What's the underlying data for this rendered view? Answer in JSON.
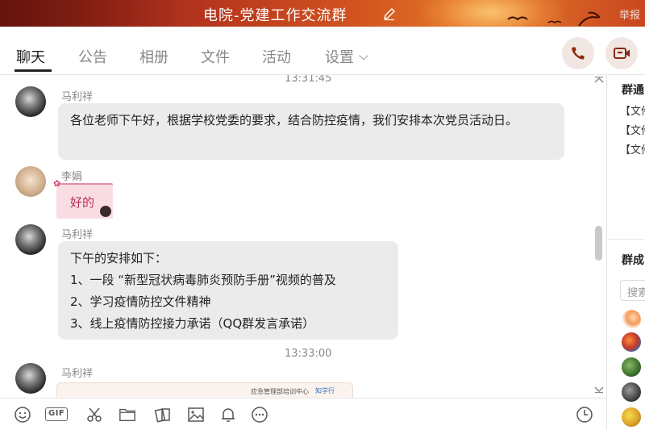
{
  "window": {
    "title": "电院-党建工作交流群",
    "report_label": "举报"
  },
  "tabs": [
    {
      "label": "聊天",
      "active": true
    },
    {
      "label": "公告",
      "active": false
    },
    {
      "label": "相册",
      "active": false
    },
    {
      "label": "文件",
      "active": false
    },
    {
      "label": "活动",
      "active": false
    },
    {
      "label": "设置",
      "active": false
    }
  ],
  "actions": {
    "call_icon": "phone-icon",
    "video_icon": "video-camera-icon"
  },
  "messages": {
    "time_top": "13:31:45",
    "m1": {
      "sender": "马利祥",
      "text": "各位老师下午好，根据学校党委的要求，结合防控疫情，我们安排本次党员活动日。"
    },
    "m2": {
      "sender": "李娟",
      "sticker_text": "好的"
    },
    "m3": {
      "sender": "马利祥",
      "lines": [
        "下午的安排如下：",
        "1、一段  “新型冠状病毒肺炎预防手册”视频的普及",
        "2、学习疫情防控文件精神",
        "3、线上疫情防控接力承诺（QQ群发言承诺）"
      ]
    },
    "time_mid": "13:33:00",
    "m4": {
      "sender": "马利祥",
      "image_caption": "应急管理部培训中心",
      "image_caption2": "知学行"
    }
  },
  "right_panel": {
    "notice_title": "群通",
    "notice_items": [
      "【文件",
      "【文件",
      "【文件"
    ],
    "members_title": "群成",
    "search_placeholder": "搜索"
  },
  "toolbar": {
    "gif_label": "GIF",
    "icons": [
      "emoji-icon",
      "gif-icon",
      "scissors-icon",
      "folder-icon",
      "image-library-icon",
      "picture-icon",
      "bell-icon",
      "more-icon",
      "history-clock-icon"
    ]
  },
  "colors": {
    "accent_title_bar": "#c2411c",
    "bubble_bg": "#ebebeb",
    "action_circle_bg": "#f1e7e2",
    "action_icon": "#8a2a12"
  }
}
